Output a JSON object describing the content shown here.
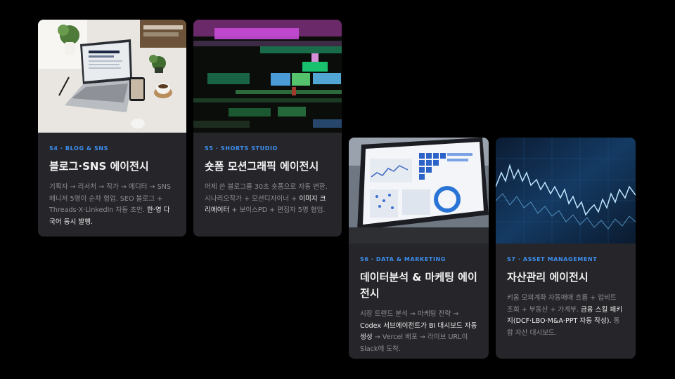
{
  "cards": [
    {
      "tag": "S4 · BLOG & SNS",
      "title": "블로그·SNS 에이전시",
      "desc_1": "기획자 → 리서처 → 작가 → 에디터 → SNS매니저 5명이 순차 협업. SEO 블로그 + Threads·X·LinkedIn 자동 초안. ",
      "desc_hl": "한·영 다국어 동시 발행.",
      "desc_2": "",
      "image": "laptop-desk-photo"
    },
    {
      "tag": "S5 · SHORTS STUDIO",
      "title": "숏폼 모션그래픽 에이전시",
      "desc_1": "어제 쓴 블로그를 30초 숏폼으로 자동 변환. 시나리오작가 + 모션디자이너 + ",
      "desc_hl": "이미지 크리에이터",
      "desc_2": " + 보이스PD + 편집자 5명 협업.",
      "image": "video-timeline-photo"
    },
    {
      "tag": "S6 · DATA & MARKETING",
      "title": "데이터분석 & 마케팅 에이전시",
      "desc_1": "시장 트렌드 분석 → 마케팅 전략 → ",
      "desc_hl": "Codex 서브에이전트가 BI 대시보드 자동 생성",
      "desc_2": " → Vercel 배포 → 라이브 URL이 Slack에 도착.",
      "image": "dashboard-laptop-photo"
    },
    {
      "tag": "S7 · ASSET MANAGEMENT",
      "title": "자산관리 에이전시",
      "desc_1": "키움 모의계좌 자동매매 흐름 + 업비트 조회 + 부동산 + 가계부. ",
      "desc_hl": "금융 스킬 패키지(DCF·LBO·M&A·PPT 자동 작성).",
      "desc_2": " 통합 자산 대시보드.",
      "image": "stock-chart-photo"
    }
  ],
  "colors": {
    "accent": "#3d8ef0",
    "card_bg": "#26262a",
    "page_bg": "#000000"
  }
}
